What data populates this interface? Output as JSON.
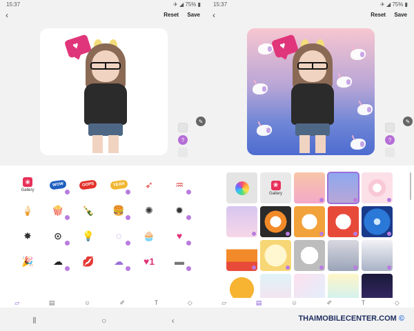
{
  "left": {
    "status": {
      "time": "15:37",
      "battery": "75%"
    },
    "topbar": {
      "reset": "Reset",
      "save": "Save"
    },
    "sticker_gallery_label": "Gallery",
    "stickers": [
      {
        "name": "gallery"
      },
      {
        "name": "wow-burst",
        "text": "WOW",
        "color": "#1f5fbf"
      },
      {
        "name": "oops-burst",
        "text": "OOPS",
        "color": "#e2332a"
      },
      {
        "name": "yeah-burst",
        "text": "YEAH",
        "color": "#f2b632"
      },
      {
        "name": "arrow-heart",
        "text": "➶",
        "color": "#e04040"
      },
      {
        "name": "ribbon",
        "text": "♒",
        "color": "#e04040"
      },
      {
        "name": "ice-cream",
        "text": "🍦",
        "color": "#f3a0c0"
      },
      {
        "name": "popcorn",
        "text": "🍿",
        "color": "#e84b3a"
      },
      {
        "name": "bottle",
        "text": "🍾",
        "color": "#a3242a"
      },
      {
        "name": "burger",
        "text": "🍔",
        "color": "#c87a2e"
      },
      {
        "name": "speech-spiky",
        "text": "✺",
        "color": "#333"
      },
      {
        "name": "speech-cloud",
        "text": "✹",
        "color": "#333"
      },
      {
        "name": "bubble-wavy",
        "text": "✸",
        "color": "#333"
      },
      {
        "name": "bubble-dots",
        "text": "⊙",
        "color": "#333"
      },
      {
        "name": "bulb",
        "text": "💡",
        "color": "#f2c230"
      },
      {
        "name": "bracelet",
        "text": "◌",
        "color": "#9a6fd8"
      },
      {
        "name": "cupcake",
        "text": "🧁",
        "color": "#a25a2e"
      },
      {
        "name": "heart-chat",
        "text": "♥",
        "color": "#e0357a"
      },
      {
        "name": "party-popper",
        "text": "🎉",
        "color": "#e0357a"
      },
      {
        "name": "thunder-cloud",
        "text": "☁",
        "color": "#222"
      },
      {
        "name": "lips",
        "text": "💋",
        "color": "#c72a7a"
      },
      {
        "name": "purple-cloud",
        "text": "☁",
        "color": "#9a6fd8"
      },
      {
        "name": "like-badge",
        "text": "♥1",
        "color": "#e0357a"
      },
      {
        "name": "tag",
        "text": "▬",
        "color": "#777"
      }
    ],
    "question_label": "?",
    "chat_label": "…"
  },
  "right": {
    "status": {
      "time": "15:37",
      "battery": "75%"
    },
    "topbar": {
      "reset": "Reset",
      "save": "Save"
    },
    "bg_gallery_label": "Gallery",
    "backgrounds": [
      {
        "name": "color-picker",
        "color": "linear-gradient(135deg,#ff6b9a,#7b6bff,#3ec6ff)"
      },
      {
        "name": "gallery",
        "color": "#e9e9e9"
      },
      {
        "name": "pastel-hearts",
        "color": "linear-gradient(180deg,#f7c6a8,#f4a8c8)"
      },
      {
        "name": "purple-hearts",
        "color": "linear-gradient(180deg,#8da8f0,#b9a6d6)"
      },
      {
        "name": "heart-rings",
        "color": "radial-gradient(circle,#fff 0 20%,#f9c8d6 20% 40%,#fbe0e8 40%)"
      },
      {
        "name": "purple-clouds",
        "color": "linear-gradient(180deg,#d7c6f0,#f7d7e8)"
      },
      {
        "name": "comic-burst-orange",
        "color": "radial-gradient(circle,#fff 0 25%,#f28a2a 25% 50%,#2a2a2a 50%)"
      },
      {
        "name": "comic-cloud-orange",
        "color": "radial-gradient(circle,#fff 0 35%,#f2a23a 35%)"
      },
      {
        "name": "comic-burst-red",
        "color": "radial-gradient(circle,#fff 0 35%,#e84a3a 35%)"
      },
      {
        "name": "comic-burst-blue",
        "color": "radial-gradient(circle,#cfe8ff 0 15%,#2a78d8 15% 60%,#1a3a8a 60%)"
      },
      {
        "name": "flames",
        "color": "linear-gradient(180deg,#fff 0 30%,#f28a2a 30% 70%,#e84a3a 70%)"
      },
      {
        "name": "sunburst-yellow",
        "color": "radial-gradient(circle,#fff7d0 0 50%,#f7d775 50%)"
      },
      {
        "name": "speed-lines-grey",
        "color": "radial-gradient(circle,#fff 0 40%,#bdbdbd 40%)"
      },
      {
        "name": "grey-fade",
        "color": "linear-gradient(180deg,#d8d8e0,#9aa4b8)"
      },
      {
        "name": "rain-lines",
        "color": "linear-gradient(180deg,#f2f2f6,#a8b2c6)"
      },
      {
        "name": "yellow-star",
        "color": "radial-gradient(circle,#f7b332 0 55%,#fff 55%)"
      },
      {
        "name": "pastel-dots",
        "color": "linear-gradient(180deg,#dff3f7,#f7e0ee)"
      },
      {
        "name": "confetti",
        "color": "linear-gradient(135deg,#fde0ee,#e0f0fd)"
      },
      {
        "name": "pastel-hearts-row",
        "color": "linear-gradient(180deg,#fff6c8,#c8f0f7)"
      },
      {
        "name": "fireworks",
        "color": "linear-gradient(180deg,#1a1a3a,#3a2a6a)"
      }
    ]
  },
  "watermark": "THAIMOBILECENTER.COM",
  "watermark_mark": "©"
}
